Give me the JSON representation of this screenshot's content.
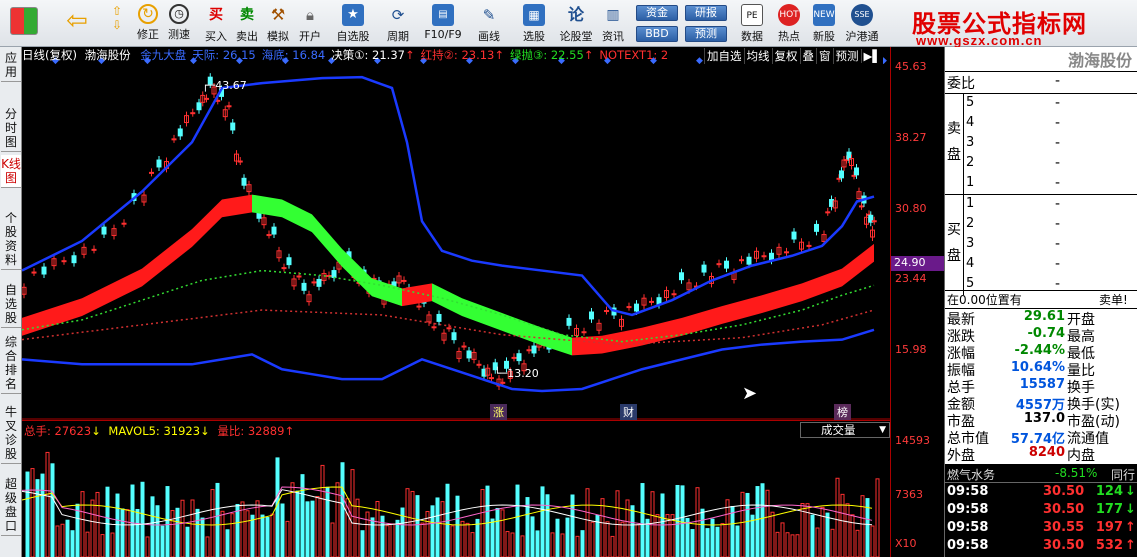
{
  "toolbar": {
    "items": [
      {
        "name": "修正",
        "icon": "up-arrow-icon"
      },
      {
        "name": "测速",
        "icon": "clock-icon"
      },
      {
        "name": "买入",
        "icon": "buy-icon"
      },
      {
        "name": "卖出",
        "icon": "sell-icon"
      },
      {
        "name": "模拟",
        "icon": "hammer-icon"
      },
      {
        "name": "开户",
        "icon": "lock-icon"
      },
      {
        "name": "自选股",
        "icon": "star-icon"
      },
      {
        "name": "周期",
        "icon": "cycle-icon"
      },
      {
        "name": "F10/F9",
        "icon": "f10-icon"
      },
      {
        "name": "画线",
        "icon": "pen-icon"
      },
      {
        "name": "选股",
        "icon": "select-icon"
      },
      {
        "name": "论股堂",
        "icon": "forum-icon"
      },
      {
        "name": "资讯",
        "icon": "news-icon"
      },
      {
        "name": "数据",
        "icon": "pe-icon"
      },
      {
        "name": "热点",
        "icon": "hot-icon"
      },
      {
        "name": "新股",
        "icon": "newstock-icon"
      },
      {
        "name": "沪港通",
        "icon": "hk-icon"
      }
    ],
    "extra": [
      "资金",
      "BBD",
      "研报",
      "预测"
    ],
    "logo": "股票公式指标网",
    "logo_url": "www.gszx.com.cn"
  },
  "left_tabs": [
    "应用",
    "分时图",
    "K线图",
    "个股资料",
    "自选股",
    "综合排名",
    "牛叉诊股",
    "超级盘口"
  ],
  "chart": {
    "header": {
      "period": "日线(复权)",
      "stock": "渤海股份",
      "labels": [
        {
          "text": "金九大盘",
          "color": "#3a6bff"
        },
        {
          "text": "天际: 26.15",
          "color": "#3a6bff"
        },
        {
          "text": "海底: 16.84",
          "color": "#3a6bff"
        },
        {
          "text": "决策①: 21.37",
          "color": "#ffffff"
        },
        {
          "text": "红持②: 23.13",
          "color": "#ff3030"
        },
        {
          "text": "绿抛③: 22.55",
          "color": "#22dd22"
        },
        {
          "text": "NOTEXT1: 2",
          "color": "#ff3030"
        }
      ],
      "buttons": [
        "加自选",
        "均线",
        "复权",
        "叠",
        "窗",
        "预测"
      ]
    },
    "markers": {
      "high": "43.67",
      "low": "13.20",
      "notes": [
        "涨",
        "财",
        "榜"
      ]
    },
    "y_ticks": [
      "45.63",
      "38.27",
      "30.80",
      "23.44",
      "15.98"
    ],
    "current_price_label": "24.90"
  },
  "volume": {
    "header": [
      {
        "text": "总手: 27623",
        "color": "#ff3030"
      },
      {
        "text": "MAVOL5: 31923",
        "color": "#ffff00"
      },
      {
        "text": "量比: 32889",
        "color": "#ff3030"
      }
    ],
    "dropdown": "成交量",
    "y_ticks": [
      "14593",
      "7363"
    ],
    "multiplier": "X10"
  },
  "chart_data": {
    "type": "candlestick",
    "price_ylim": [
      13.2,
      45.63
    ],
    "high": 43.67,
    "low": 13.2,
    "last": 29.61,
    "indicator_values": {
      "天际": 26.15,
      "海底": 16.84,
      "决策①": 21.37,
      "红持②": 23.13,
      "绿抛③": 22.55
    },
    "volume": {
      "总手": 27623,
      "MAVOL5": 31923,
      "量比": 32889,
      "ylim_ticks": [
        7363,
        14593
      ]
    }
  },
  "panel": {
    "title": "渤海股份",
    "weibi_label": "委比",
    "weibi_value": "-",
    "sell_label": "卖盘",
    "buy_label": "买盘",
    "sell_levels": [
      "5",
      "4",
      "3",
      "2",
      "1"
    ],
    "buy_levels": [
      "1",
      "2",
      "3",
      "4",
      "5"
    ],
    "dash": "-",
    "position_text": "在0.00位置有",
    "position_tag": "卖单!",
    "stats": [
      {
        "label": "最新",
        "value": "29.61",
        "color": "#008800",
        "label2": "开盘"
      },
      {
        "label": "涨跌",
        "value": "-0.74",
        "color": "#008800",
        "label2": "最高"
      },
      {
        "label": "涨幅",
        "value": "-2.44%",
        "color": "#008800",
        "label2": "最低"
      },
      {
        "label": "振幅",
        "value": "10.64%",
        "color": "#0055dd",
        "label2": "量比"
      },
      {
        "label": "总手",
        "value": "15587",
        "color": "#0055dd",
        "label2": "换手"
      },
      {
        "label": "金额",
        "value": "4557万",
        "color": "#0055dd",
        "label2": "换手(实)"
      },
      {
        "label": "市盈",
        "value": "137.0",
        "color": "#000000",
        "label2": "市盈(动)"
      },
      {
        "label": "总市值",
        "value": "57.74亿",
        "color": "#0055dd",
        "label2": "流通值"
      },
      {
        "label": "外盘",
        "value": "8240",
        "color": "#cc0000",
        "label2": "内盘"
      }
    ],
    "sector": "燃气水务",
    "sector_change": "-8.51%",
    "sector_tag": "同行",
    "ticks": [
      {
        "time": "09:58",
        "price": "30.50",
        "vol": "124"
      },
      {
        "time": "09:58",
        "price": "30.50",
        "vol": "177"
      },
      {
        "time": "09:58",
        "price": "30.55",
        "vol": "197"
      },
      {
        "time": "09:58",
        "price": "30.50",
        "vol": "532"
      }
    ]
  }
}
